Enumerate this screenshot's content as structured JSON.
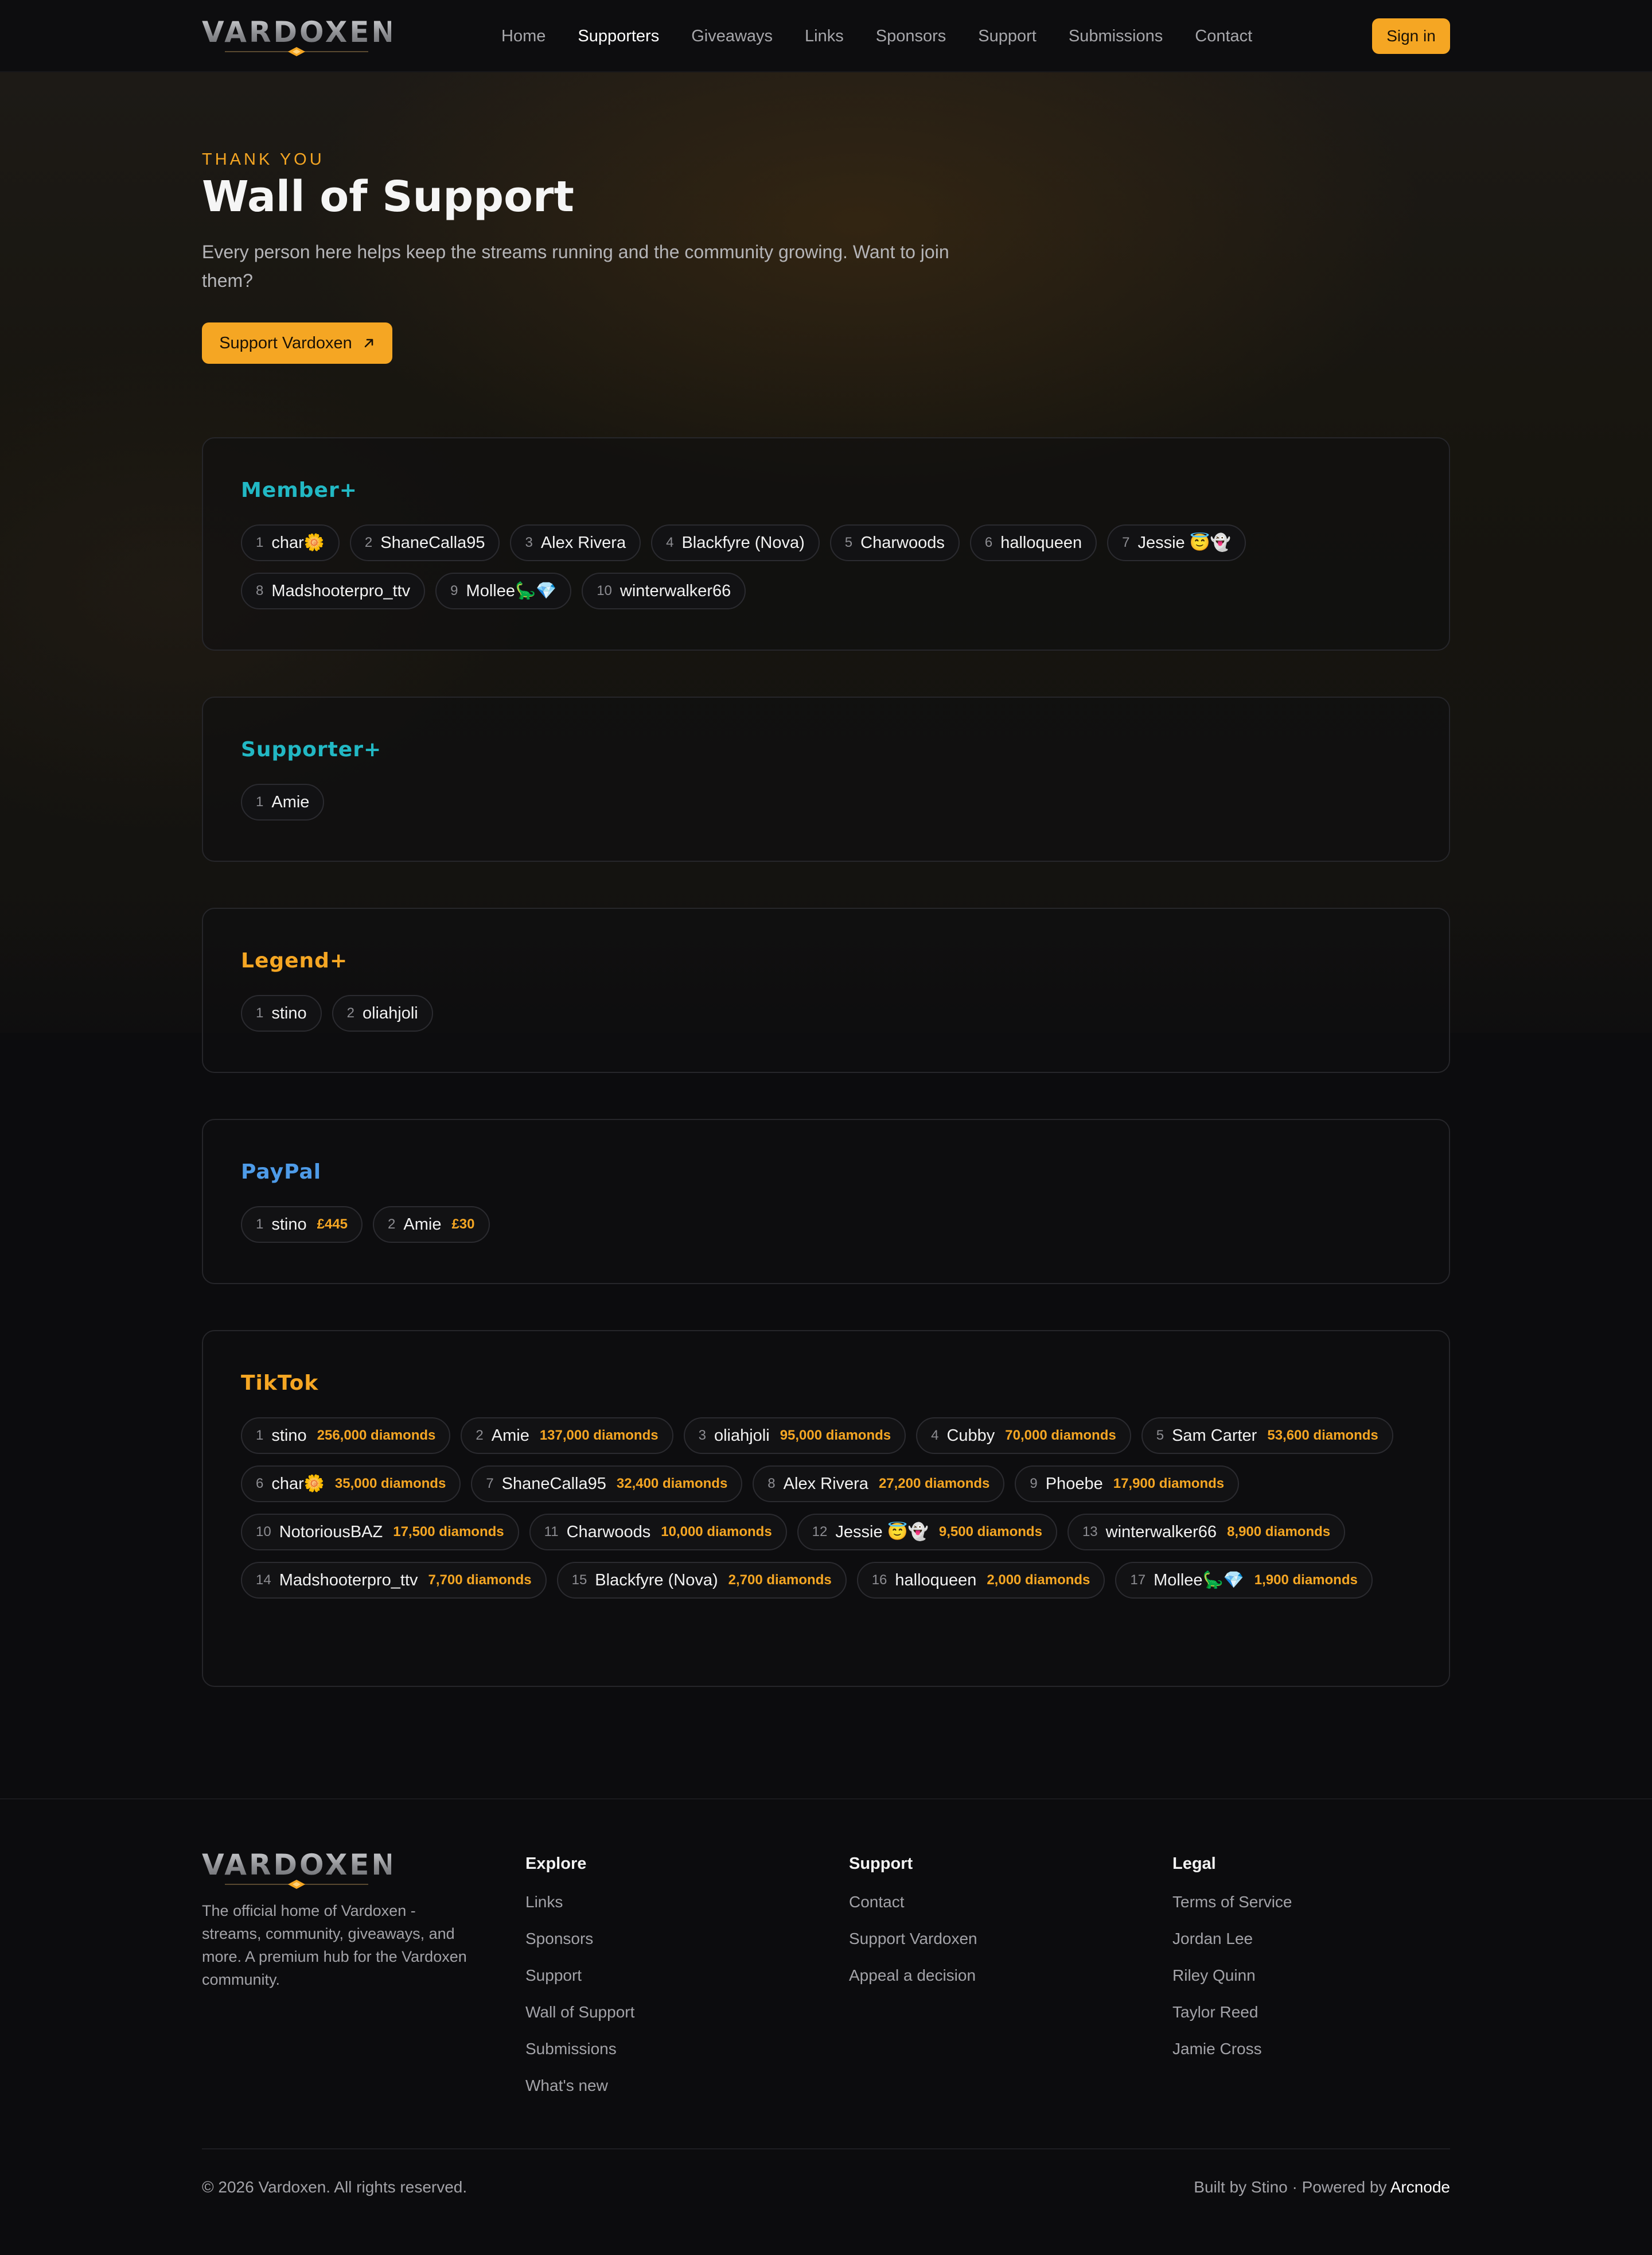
{
  "brand": {
    "name": "VARDOXEN",
    "accent": "#f5a623"
  },
  "nav": {
    "links": [
      "Home",
      "Supporters",
      "Giveaways",
      "Links",
      "Sponsors",
      "Support",
      "Submissions",
      "Contact"
    ],
    "active": "Supporters",
    "signin_label": "Sign in"
  },
  "hero": {
    "eyebrow": "THANK YOU",
    "title": "Wall of Support",
    "subtitle": "Every person here helps keep the streams running and the community growing. Want to join them?",
    "cta_label": "Support Vardoxen",
    "cta_icon": "arrow-up-right-icon"
  },
  "tiers": [
    {
      "title": "Member+",
      "color": "#22b8c4",
      "supporters": [
        {
          "rank": "1",
          "name": "char🌼"
        },
        {
          "rank": "2",
          "name": "ShaneCalla95"
        },
        {
          "rank": "3",
          "name": "Alex Rivera"
        },
        {
          "rank": "4",
          "name": "Blackfyre (Nova)"
        },
        {
          "rank": "5",
          "name": "Charwoods"
        },
        {
          "rank": "6",
          "name": "halloqueen"
        },
        {
          "rank": "7",
          "name": "Jessie 😇👻"
        },
        {
          "rank": "8",
          "name": "Madshooterpro_ttv"
        },
        {
          "rank": "9",
          "name": "Mollee🦕💎"
        },
        {
          "rank": "10",
          "name": "winterwalker66"
        }
      ]
    },
    {
      "title": "Supporter+",
      "color": "#22b8c4",
      "supporters": [
        {
          "rank": "1",
          "name": "Amie"
        }
      ]
    },
    {
      "title": "Legend+",
      "color": "#f5a623",
      "supporters": [
        {
          "rank": "1",
          "name": "stino"
        },
        {
          "rank": "2",
          "name": "oliahjoli"
        }
      ]
    },
    {
      "title": "PayPal",
      "color": "#4e9be8",
      "supporters": [
        {
          "rank": "1",
          "name": "stino",
          "amount": "£445"
        },
        {
          "rank": "2",
          "name": "Amie",
          "amount": "£30"
        }
      ]
    },
    {
      "title": "TikTok",
      "color": "#f5a623",
      "supporters": [
        {
          "rank": "1",
          "name": "stino",
          "amount": "256,000 diamonds"
        },
        {
          "rank": "2",
          "name": "Amie",
          "amount": "137,000 diamonds"
        },
        {
          "rank": "3",
          "name": "oliahjoli",
          "amount": "95,000 diamonds"
        },
        {
          "rank": "4",
          "name": "Cubby",
          "amount": "70,000 diamonds"
        },
        {
          "rank": "5",
          "name": "Sam Carter",
          "amount": "53,600 diamonds"
        },
        {
          "rank": "6",
          "name": "char🌼",
          "amount": "35,000 diamonds"
        },
        {
          "rank": "7",
          "name": "ShaneCalla95",
          "amount": "32,400 diamonds"
        },
        {
          "rank": "8",
          "name": "Alex Rivera",
          "amount": "27,200 diamonds"
        },
        {
          "rank": "9",
          "name": "Phoebe",
          "amount": "17,900 diamonds"
        },
        {
          "rank": "10",
          "name": "NotoriousBAZ",
          "amount": "17,500 diamonds"
        },
        {
          "rank": "11",
          "name": "Charwoods",
          "amount": "10,000 diamonds"
        },
        {
          "rank": "12",
          "name": "Jessie 😇👻",
          "amount": "9,500 diamonds"
        },
        {
          "rank": "13",
          "name": "winterwalker66",
          "amount": "8,900 diamonds"
        },
        {
          "rank": "14",
          "name": "Madshooterpro_ttv",
          "amount": "7,700 diamonds"
        },
        {
          "rank": "15",
          "name": "Blackfyre (Nova)",
          "amount": "2,700 diamonds"
        },
        {
          "rank": "16",
          "name": "halloqueen",
          "amount": "2,000 diamonds"
        },
        {
          "rank": "17",
          "name": "Mollee🦕💎",
          "amount": "1,900 diamonds"
        }
      ]
    }
  ],
  "footer": {
    "description": "The official home of Vardoxen - streams, community, giveaways, and more. A premium hub for the Vardoxen community.",
    "columns": [
      {
        "heading": "Explore",
        "links": [
          "Links",
          "Sponsors",
          "Support",
          "Wall of Support",
          "Submissions",
          "What's new"
        ]
      },
      {
        "heading": "Support",
        "links": [
          "Contact",
          "Support Vardoxen",
          "Appeal a decision"
        ]
      },
      {
        "heading": "Legal",
        "links": [
          "Terms of Service",
          "Jordan Lee",
          "Riley Quinn",
          "Taylor Reed",
          "Jamie Cross"
        ]
      }
    ],
    "copyright": "© 2026 Vardoxen. All rights reserved.",
    "built_by": "Built by Stino · Powered by ",
    "powered_by": "Arcnode"
  }
}
